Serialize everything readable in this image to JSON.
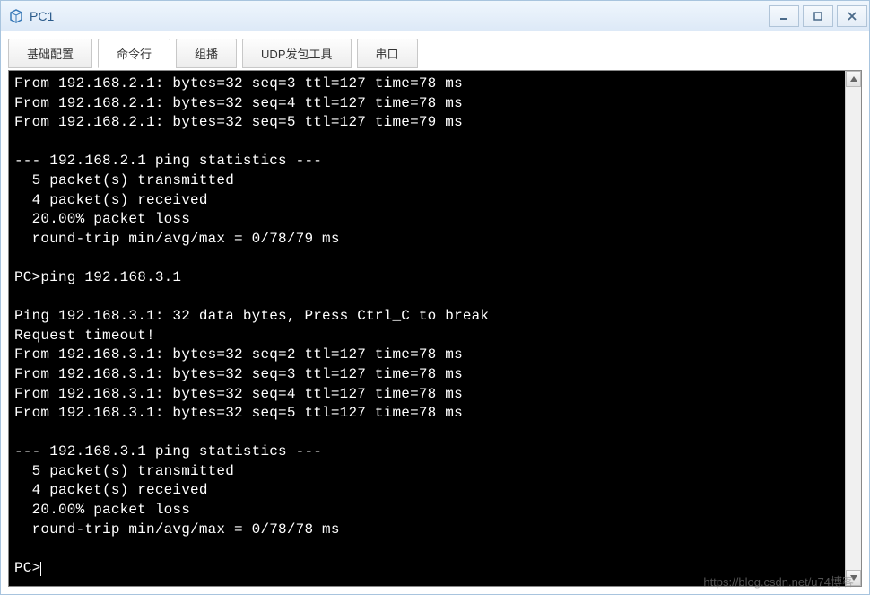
{
  "window": {
    "title": "PC1"
  },
  "tabs": [
    {
      "label": "基础配置",
      "active": false
    },
    {
      "label": "命令行",
      "active": true
    },
    {
      "label": "组播",
      "active": false
    },
    {
      "label": "UDP发包工具",
      "active": false
    },
    {
      "label": "串口",
      "active": false
    }
  ],
  "terminal": {
    "lines": [
      "From 192.168.2.1: bytes=32 seq=3 ttl=127 time=78 ms",
      "From 192.168.2.1: bytes=32 seq=4 ttl=127 time=78 ms",
      "From 192.168.2.1: bytes=32 seq=5 ttl=127 time=79 ms",
      "",
      "--- 192.168.2.1 ping statistics ---",
      "  5 packet(s) transmitted",
      "  4 packet(s) received",
      "  20.00% packet loss",
      "  round-trip min/avg/max = 0/78/79 ms",
      "",
      "PC>ping 192.168.3.1",
      "",
      "Ping 192.168.3.1: 32 data bytes, Press Ctrl_C to break",
      "Request timeout!",
      "From 192.168.3.1: bytes=32 seq=2 ttl=127 time=78 ms",
      "From 192.168.3.1: bytes=32 seq=3 ttl=127 time=78 ms",
      "From 192.168.3.1: bytes=32 seq=4 ttl=127 time=78 ms",
      "From 192.168.3.1: bytes=32 seq=5 ttl=127 time=78 ms",
      "",
      "--- 192.168.3.1 ping statistics ---",
      "  5 packet(s) transmitted",
      "  4 packet(s) received",
      "  20.00% packet loss",
      "  round-trip min/avg/max = 0/78/78 ms",
      "",
      "PC>"
    ],
    "prompt": "PC>"
  },
  "watermark": "https://blog.csdn.net/u74博客"
}
